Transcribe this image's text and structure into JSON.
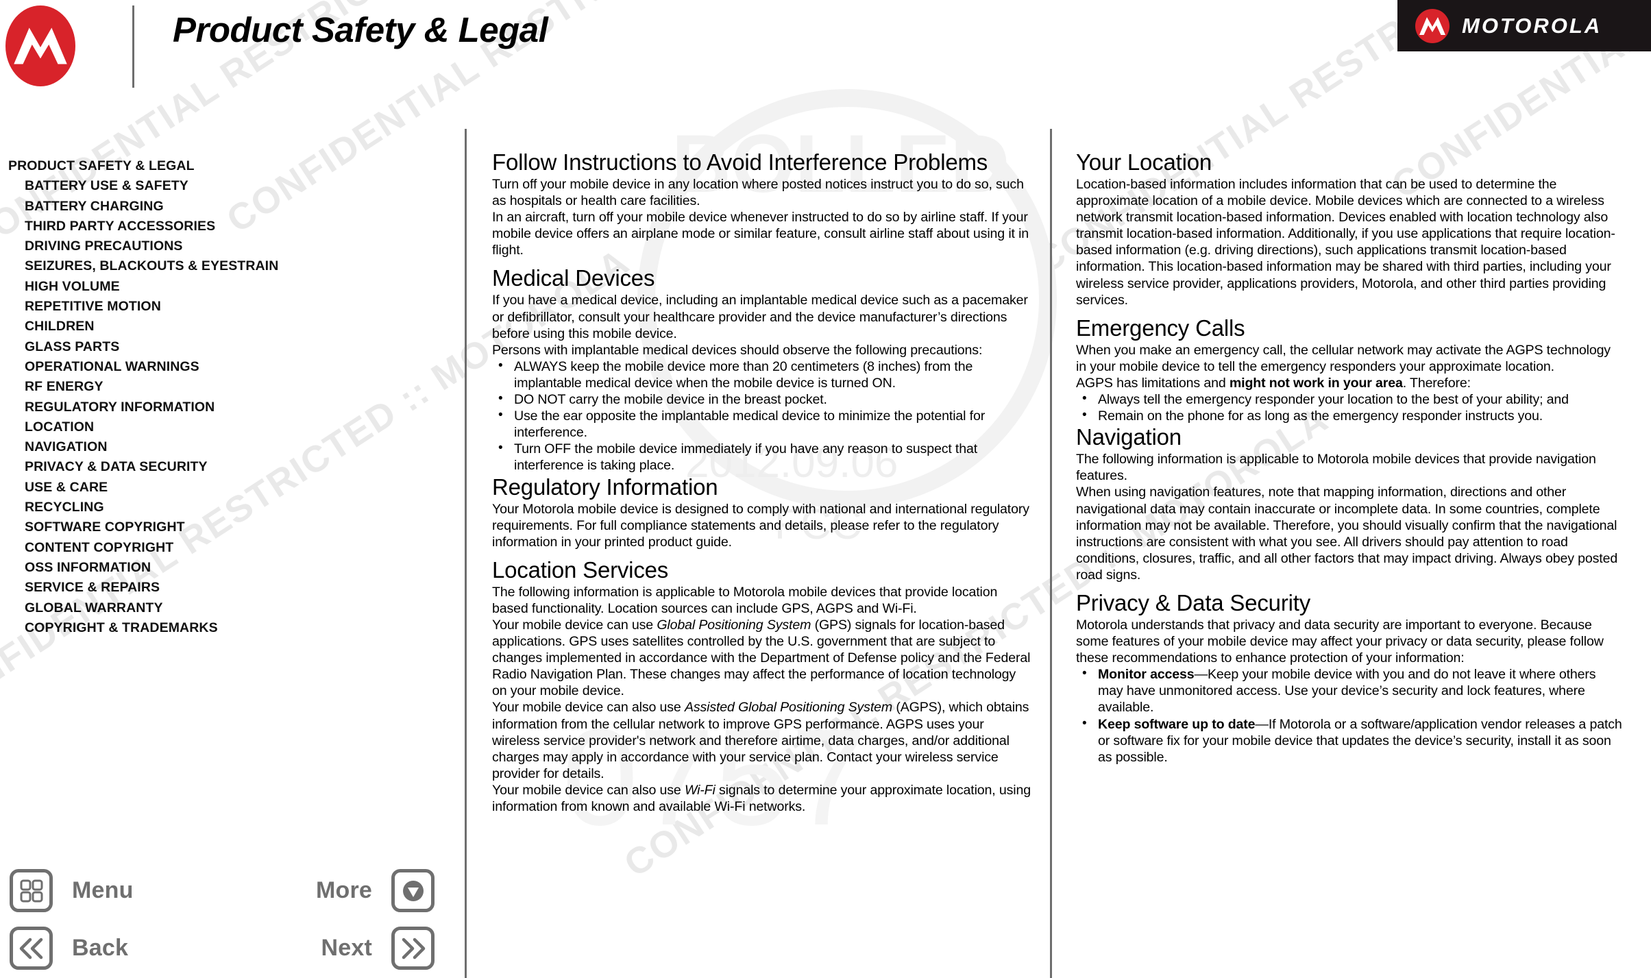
{
  "header": {
    "title": "Product Safety & Legal",
    "logo_icon": "motorola-batwing-icon",
    "brand_word": "MOTOROLA",
    "brand_mark_icon": "motorola-batwing-icon"
  },
  "watermark": {
    "text": "CONFIDENTIAL RESTRICTED :: MOTOROLA",
    "date": "2012.09.06",
    "agency": "FCC"
  },
  "sidebar": {
    "items": [
      {
        "label": "PRODUCT SAFETY & LEGAL",
        "level": 0
      },
      {
        "label": "BATTERY USE & SAFETY",
        "level": 1
      },
      {
        "label": "BATTERY CHARGING",
        "level": 1
      },
      {
        "label": "THIRD PARTY ACCESSORIES",
        "level": 1
      },
      {
        "label": "DRIVING PRECAUTIONS",
        "level": 1
      },
      {
        "label": "SEIZURES, BLACKOUTS & EYESTRAIN",
        "level": 1
      },
      {
        "label": "HIGH VOLUME",
        "level": 1
      },
      {
        "label": "REPETITIVE MOTION",
        "level": 1
      },
      {
        "label": "CHILDREN",
        "level": 1
      },
      {
        "label": "GLASS PARTS",
        "level": 1
      },
      {
        "label": "OPERATIONAL WARNINGS",
        "level": 1
      },
      {
        "label": "RF ENERGY",
        "level": 1
      },
      {
        "label": "REGULATORY INFORMATION",
        "level": 1
      },
      {
        "label": "LOCATION",
        "level": 1
      },
      {
        "label": "NAVIGATION",
        "level": 1
      },
      {
        "label": "PRIVACY & DATA SECURITY",
        "level": 1
      },
      {
        "label": "USE & CARE",
        "level": 1
      },
      {
        "label": "RECYCLING",
        "level": 1
      },
      {
        "label": "SOFTWARE COPYRIGHT",
        "level": 1
      },
      {
        "label": "CONTENT COPYRIGHT",
        "level": 1
      },
      {
        "label": "OSS INFORMATION",
        "level": 1
      },
      {
        "label": "SERVICE & REPAIRS",
        "level": 1
      },
      {
        "label": "GLOBAL WARRANTY",
        "level": 1
      },
      {
        "label": "COPYRIGHT & TRADEMARKS",
        "level": 1
      }
    ]
  },
  "middle_column": {
    "interference_heading": "Follow Instructions to Avoid Interference Problems",
    "interference_p1": "Turn off your mobile device in any location where posted notices instruct you to do so, such as hospitals or health care facilities.",
    "interference_p2": "In an aircraft, turn off your mobile device whenever instructed to do so by airline staff. If your mobile device offers an airplane mode or similar feature, consult airline staff about using it in flight.",
    "medical_heading": "Medical Devices",
    "medical_p1": "If you have a medical device, including an implantable medical device such as a pacemaker or defibrillator, consult your healthcare provider and the device manufacturer’s directions before using this mobile device.",
    "medical_p2": "Persons with implantable medical devices should observe the following precautions:",
    "medical_bullets": [
      "ALWAYS keep the mobile device more than 20 centimeters (8 inches) from the implantable medical device when the mobile device is turned ON.",
      "DO NOT carry the mobile device in the breast pocket.",
      "Use the ear opposite the implantable medical device to minimize the potential for interference.",
      "Turn OFF the mobile device immediately if you have any reason to suspect that interference is taking place."
    ],
    "regulatory_heading": "Regulatory Information",
    "regulatory_p1": "Your Motorola mobile device is designed to comply with national and international regulatory requirements. For full compliance statements and details, please refer to the regulatory information in your printed product guide.",
    "location_services_heading": "Location Services",
    "location_p1": "The following information is applicable to Motorola mobile devices that provide location based functionality. Location sources can include GPS, AGPS and Wi-Fi.",
    "location_p2_a": "Your mobile device can use ",
    "location_p2_em": "Global Positioning System",
    "location_p2_b": " (GPS) signals for location-based applications. GPS uses satellites controlled by the U.S. government that are subject to changes implemented in accordance with the Department of Defense policy and the Federal Radio Navigation Plan. These changes may affect the performance of location technology on your mobile device.",
    "location_p3_a": "Your mobile device can also use ",
    "location_p3_em": "Assisted Global Positioning System",
    "location_p3_b": " (AGPS), which obtains information from the cellular network to improve GPS performance. AGPS uses your wireless service provider's network and therefore airtime, data charges, and/or additional charges may apply in accordance with your service plan. Contact your wireless service provider for details.",
    "location_p4_a": "Your mobile device can also use ",
    "location_p4_em": "Wi-Fi",
    "location_p4_b": " signals to determine your approximate location, using information from known and available Wi-Fi networks."
  },
  "right_column": {
    "your_location_heading": "Your Location",
    "your_location_p1": "Location-based information includes information that can be used to determine the approximate location of a mobile device. Mobile devices which are connected to a wireless network transmit location-based information. Devices enabled with location technology also transmit location-based information. Additionally, if you use applications that require location-based information (e.g. driving directions), such applications transmit location-based information. This location-based information may be shared with third parties, including your wireless service provider, applications providers, Motorola, and other third parties providing services.",
    "emergency_heading": "Emergency Calls",
    "emergency_p1": "When you make an emergency call, the cellular network may activate the AGPS technology in your mobile device to tell the emergency responders your approximate location.",
    "emergency_p2_a": "AGPS has limitations and ",
    "emergency_p2_strong": "might not work in your area",
    "emergency_p2_b": ". Therefore:",
    "emergency_bullets": [
      "Always tell the emergency responder your location to the best of your ability; and",
      "Remain on the phone for as long as the emergency responder instructs you."
    ],
    "navigation_heading": "Navigation",
    "navigation_p1": "The following information is applicable to Motorola mobile devices that provide navigation features.",
    "navigation_p2": "When using navigation features, note that mapping information, directions and other navigational data may contain inaccurate or incomplete data. In some countries, complete information may not be available. Therefore, you should visually confirm that the navigational instructions are consistent with what you see. All drivers should pay attention to road conditions, closures, traffic, and all other factors that may impact driving. Always obey posted road signs.",
    "privacy_heading": "Privacy & Data Security",
    "privacy_p1": "Motorola understands that privacy and data security are important to everyone. Because some features of your mobile device may affect your privacy or data security, please follow these recommendations to enhance protection of your information:",
    "privacy_bullets": [
      {
        "lead": "Monitor access",
        "rest": "—Keep your mobile device with you and do not leave it where others may have unmonitored access. Use your device’s security and lock features, where available."
      },
      {
        "lead": "Keep software up to date",
        "rest": "—If Motorola or a software/application vendor releases a patch or software fix for your mobile device that updates the device’s security, install it as soon as possible."
      }
    ]
  },
  "bottom_nav": {
    "menu_label": "Menu",
    "menu_icon": "grid-menu-icon",
    "back_label": "Back",
    "back_icon": "double-chevron-left-icon",
    "more_label": "More",
    "more_icon": "chevron-down-circle-icon",
    "next_label": "Next",
    "next_icon": "double-chevron-right-icon"
  },
  "colors": {
    "brand_red": "#d8232a",
    "brand_plate_bg": "#1a1517",
    "nav_grey": "#6f6f6f",
    "divider_grey": "#6e6e6e"
  }
}
